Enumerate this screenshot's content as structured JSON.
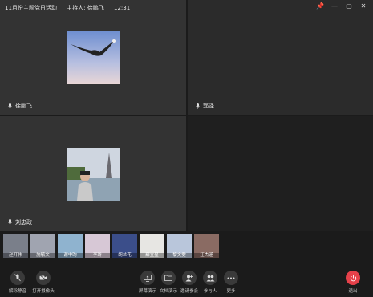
{
  "window": {
    "meeting_title": "11月份主题党日活动",
    "host_text": "主持人: 徐鹏飞",
    "time": "12:31",
    "controls": [
      "pin",
      "minimize",
      "maximize",
      "close"
    ]
  },
  "tiles": [
    {
      "name": "徐鹏飞",
      "avatar": "eagle-sky"
    },
    {
      "name": "郭泽",
      "avatar": ""
    },
    {
      "name": "刘忠政",
      "avatar": "eiffel-person"
    },
    {
      "name": "",
      "avatar": ""
    }
  ],
  "participants": [
    {
      "name": "赵开伟"
    },
    {
      "name": "施毓文"
    },
    {
      "name": "谢中昀"
    },
    {
      "name": "李玲"
    },
    {
      "name": "胡兰花"
    },
    {
      "name": "薛立星"
    },
    {
      "name": "黎文雯"
    },
    {
      "name": "汪杰涵"
    }
  ],
  "toolbar": {
    "unmute": "解除静音",
    "camera": "打开摄像头",
    "screen_share": "屏幕演示",
    "doc_share": "文档演示",
    "invite": "邀请参会",
    "participants": "参与人",
    "more": "更多",
    "leave": "退出"
  },
  "colors": {
    "leave": "#e5414a",
    "background": "#1b1b1b",
    "tile": "#333333"
  }
}
